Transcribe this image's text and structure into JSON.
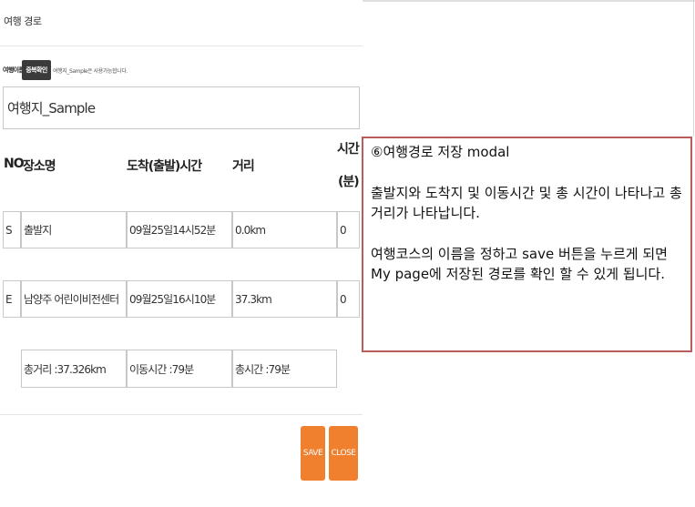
{
  "modal": {
    "title": "여행 경로",
    "name_label": "여행이름",
    "dup_check_label": "중복확인",
    "availability_hint": "여행지_Sample은 사용가능합니다.",
    "route_name_value": "여행지_Sample",
    "headers": {
      "no": "NO",
      "place": "장소명",
      "time": "도착(출발)시간",
      "distance": "거리",
      "duration_line1": "시간",
      "duration_line2": "(분)"
    },
    "rows": [
      {
        "no": "S",
        "place": "출발지",
        "time": "09월25일14시52분",
        "distance": "0.0km",
        "duration": "0"
      },
      {
        "no": "E",
        "place": "남양주 어린이비전센터",
        "time": "09월25일16시10분",
        "distance": "37.3km",
        "duration": "0"
      }
    ],
    "summary": {
      "total_distance": "총거리 :37.326km",
      "travel_time": "이동시간 :79분",
      "total_time": "총시간 :79분"
    },
    "save_label": "SAVE",
    "close_label": "CLOSE"
  },
  "annotation": {
    "title": "⑥여행경로 저장 modal",
    "para1": "출발지와 도착지 및 이동시간 및 총 시간이 나타나고 총 거리가 나타납니다.",
    "para2": "여행코스의 이름을 정하고 save 버튼을 누르게 되면 My page에 저장된 경로를 확인 할 수 있게 됩니다."
  },
  "colors": {
    "button_orange": "#f07f2e",
    "dup_button_dark": "#3a3a3a",
    "annotation_border": "#b85c5c"
  }
}
